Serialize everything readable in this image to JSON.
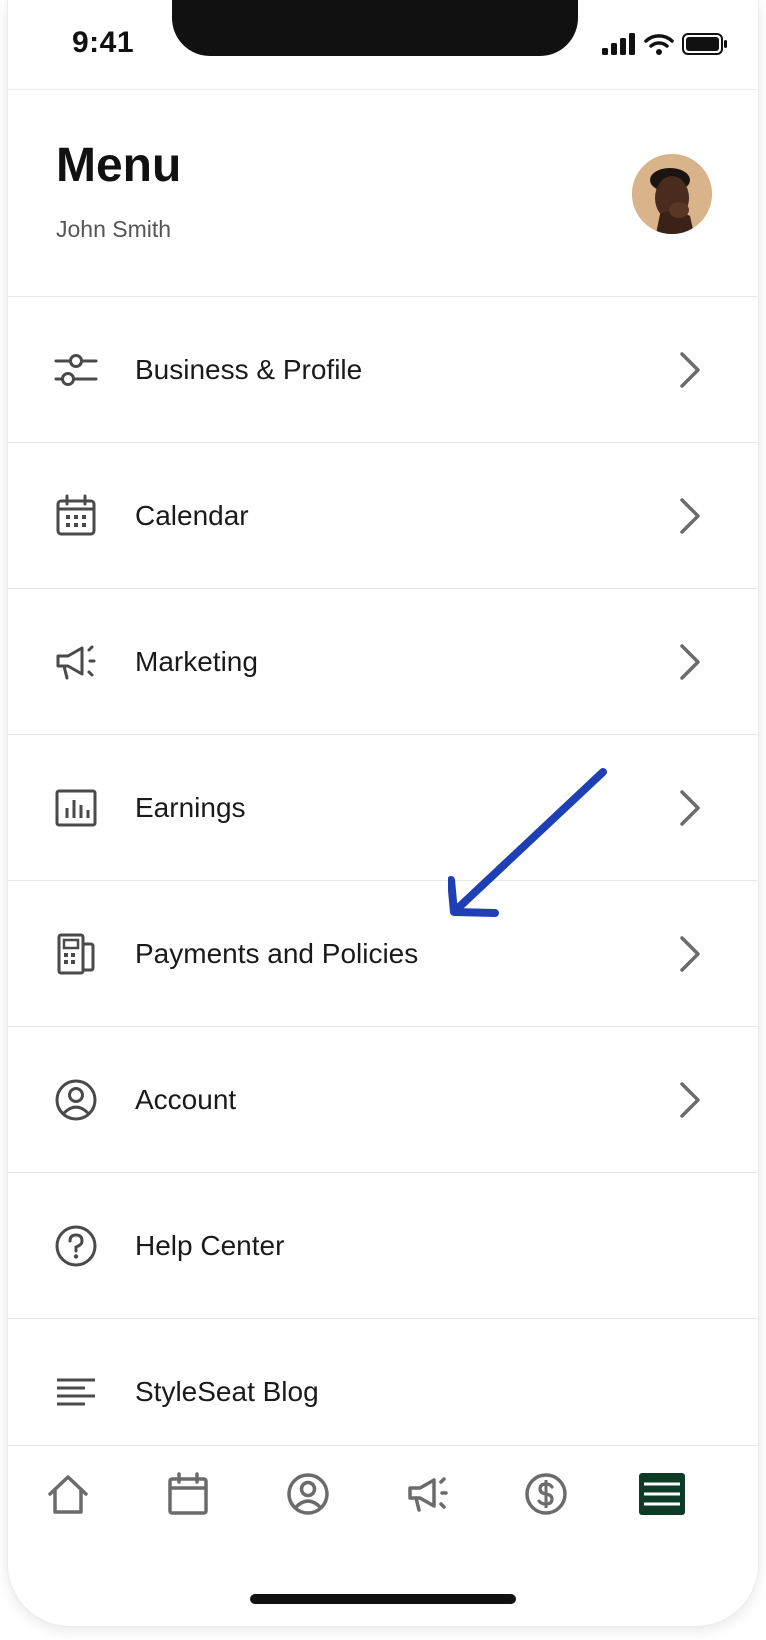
{
  "status_bar": {
    "time": "9:41"
  },
  "header": {
    "title": "Menu",
    "user_name": "John Smith"
  },
  "menu": {
    "items": [
      {
        "label": "Business & Profile",
        "icon": "sliders-icon",
        "has_chevron": true
      },
      {
        "label": "Calendar",
        "icon": "calendar-icon",
        "has_chevron": true
      },
      {
        "label": "Marketing",
        "icon": "megaphone-icon",
        "has_chevron": true
      },
      {
        "label": "Earnings",
        "icon": "bar-chart-icon",
        "has_chevron": true
      },
      {
        "label": "Payments and Policies",
        "icon": "payment-terminal-icon",
        "has_chevron": true
      },
      {
        "label": "Account",
        "icon": "user-circle-icon",
        "has_chevron": true
      },
      {
        "label": "Help Center",
        "icon": "help-circle-icon",
        "has_chevron": false
      },
      {
        "label": "StyleSeat Blog",
        "icon": "text-lines-icon",
        "has_chevron": false
      }
    ]
  },
  "tab_bar": {
    "tabs": [
      {
        "name": "home-icon",
        "active": false
      },
      {
        "name": "calendar-icon",
        "active": false
      },
      {
        "name": "user-circle-icon",
        "active": false
      },
      {
        "name": "megaphone-icon",
        "active": false
      },
      {
        "name": "dollar-circle-icon",
        "active": false
      },
      {
        "name": "menu-icon",
        "active": true
      }
    ]
  },
  "colors": {
    "icon": "#4a4a4a",
    "chevron": "#6b6b6b",
    "active_tab": "#0e3b25",
    "annotation": "#1f3fb5"
  }
}
